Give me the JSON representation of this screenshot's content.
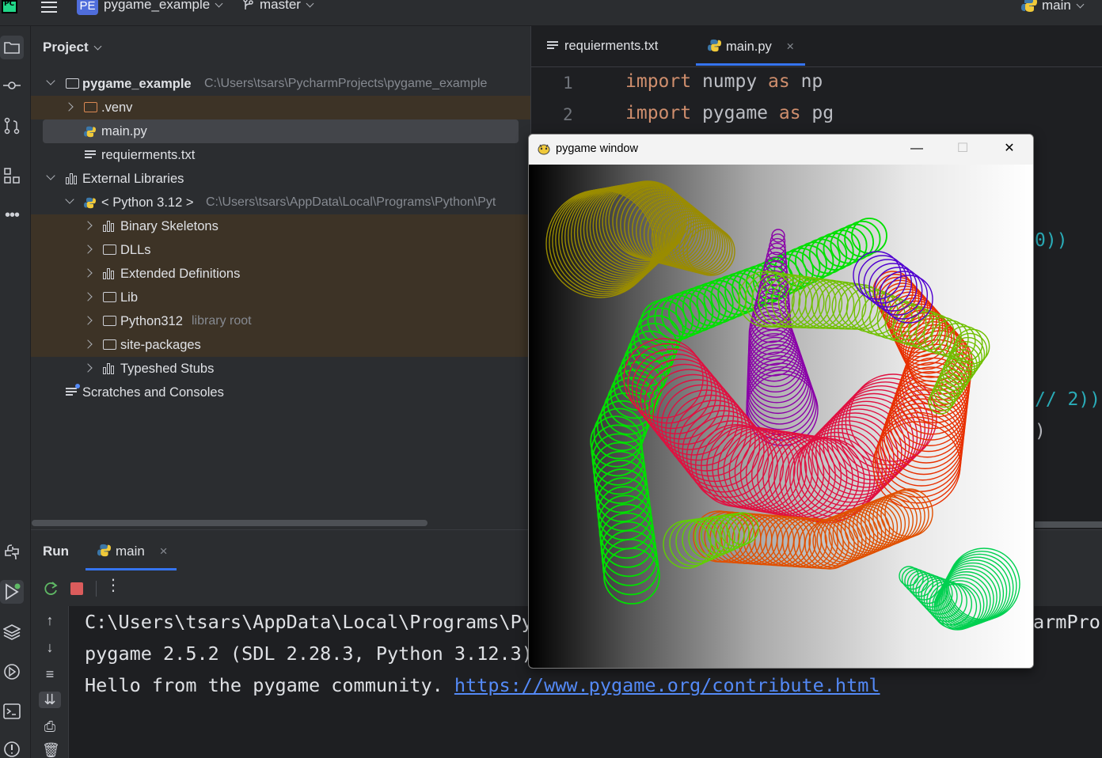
{
  "titlebar": {
    "project_badge": "PE",
    "project_name": "pygame_example",
    "branch": "master",
    "run_config": "main"
  },
  "project_panel": {
    "title": "Project",
    "tree": [
      {
        "label": "pygame_example",
        "path": "C:\\Users\\tsars\\PycharmProjects\\pygame_example"
      },
      {
        "label": ".venv"
      },
      {
        "label": "main.py"
      },
      {
        "label": "requierments.txt"
      },
      {
        "label": "External Libraries"
      },
      {
        "label": "< Python 3.12 >",
        "path": "C:\\Users\\tsars\\AppData\\Local\\Programs\\Python\\Pyt"
      },
      {
        "label": "Binary Skeletons"
      },
      {
        "label": "DLLs"
      },
      {
        "label": "Extended Definitions"
      },
      {
        "label": "Lib"
      },
      {
        "label": "Python312",
        "hint": "library root"
      },
      {
        "label": "site-packages"
      },
      {
        "label": "Typeshed Stubs"
      },
      {
        "label": "Scratches and Consoles"
      }
    ]
  },
  "editor": {
    "tabs": [
      {
        "label": "requierments.txt"
      },
      {
        "label": "main.py",
        "close": "×"
      }
    ],
    "lines": [
      {
        "num": "1",
        "kw1": "import",
        "mod": " numpy ",
        "kw2": "as",
        "alias": " np"
      },
      {
        "num": "2",
        "kw1": "import",
        "mod": " pygame ",
        "kw2": "as",
        "alias": " pg"
      }
    ],
    "fragments": {
      "frag1": "0))",
      "frag2": "// 2))",
      "frag3": ")",
      "frag4": "armProj"
    }
  },
  "run_panel": {
    "title": "Run",
    "tab_label": "main",
    "tab_close": "×",
    "console": [
      "C:\\Users\\tsars\\AppData\\Local\\Programs\\Py",
      "pygame 2.5.2 (SDL 2.28.3, Python 3.12.3)",
      "Hello from the pygame community. "
    ],
    "link": "https://www.pygame.org/contribute.html"
  },
  "pygame_window": {
    "title": "pygame window",
    "minimize": "—",
    "maximize": "☐",
    "close": "✕"
  },
  "colors": {
    "accent": "#3574f0",
    "keyword": "#cf8e6d",
    "link": "#548af7",
    "excluded_bg": "#3d3326"
  }
}
